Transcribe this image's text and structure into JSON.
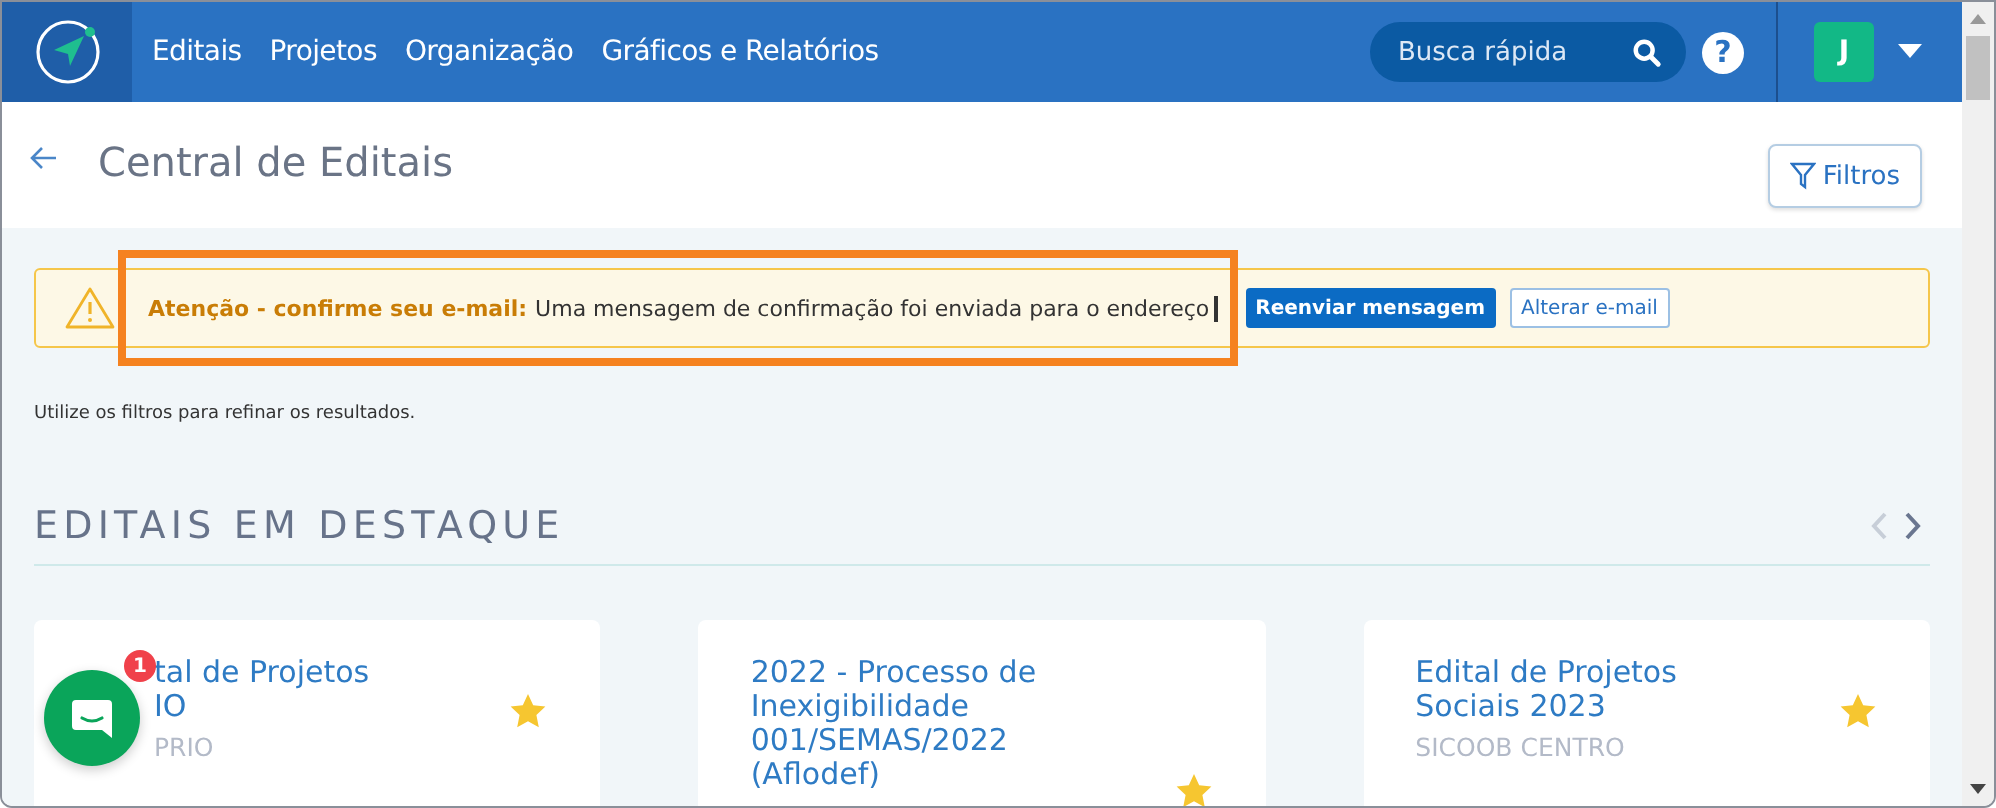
{
  "nav": {
    "items": [
      "Editais",
      "Projetos",
      "Organização",
      "Gráficos e Relatórios"
    ],
    "search": {
      "placeholder": "Busca rápida"
    },
    "help": "?",
    "avatar": "J"
  },
  "header": {
    "title": "Central de Editais",
    "filter_button": "Filtros"
  },
  "alert": {
    "title": "Atenção - confirme seu e-mail:",
    "message": "Uma mensagem de confirmação foi enviada para o endereço",
    "buttons": [
      {
        "label": "Reenviar mensagem",
        "kind": "primary"
      },
      {
        "label": "Alterar e-mail",
        "kind": "outline"
      }
    ]
  },
  "hint": "Utilize os filtros para refinar os resultados.",
  "featured": {
    "title": "EDITAIS EM DESTAQUE",
    "prev_disabled": true,
    "next_disabled": false,
    "cards": [
      {
        "title_lines": [
          "tal de Projetos",
          "IO"
        ],
        "org": "PRIO",
        "starred": true
      },
      {
        "title_lines": [
          "2022 - Processo de",
          "Inexigibilidade",
          "001/SEMAS/2022",
          "(Aflodef)"
        ],
        "starred": true
      },
      {
        "title_lines": [
          "Edital de Projetos",
          "Sociais 2023"
        ],
        "org": "SICOOB CENTRO",
        "starred": true
      }
    ]
  },
  "chat": {
    "badge": "1"
  }
}
